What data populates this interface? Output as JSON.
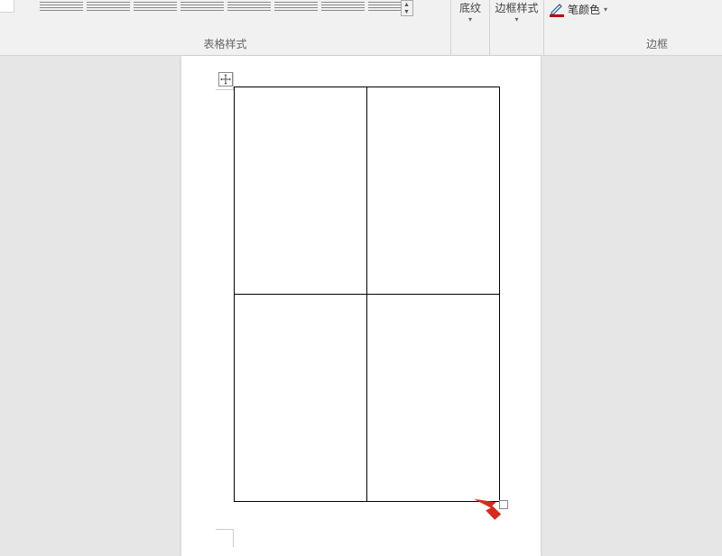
{
  "ribbon": {
    "table_styles_label": "表格样式",
    "shading_label": "底纹",
    "border_style_label": "边框样式",
    "pen_color_label": "笔颜色",
    "borders_group_label": "边框"
  },
  "table": {
    "rows": 2,
    "cols": 2
  }
}
